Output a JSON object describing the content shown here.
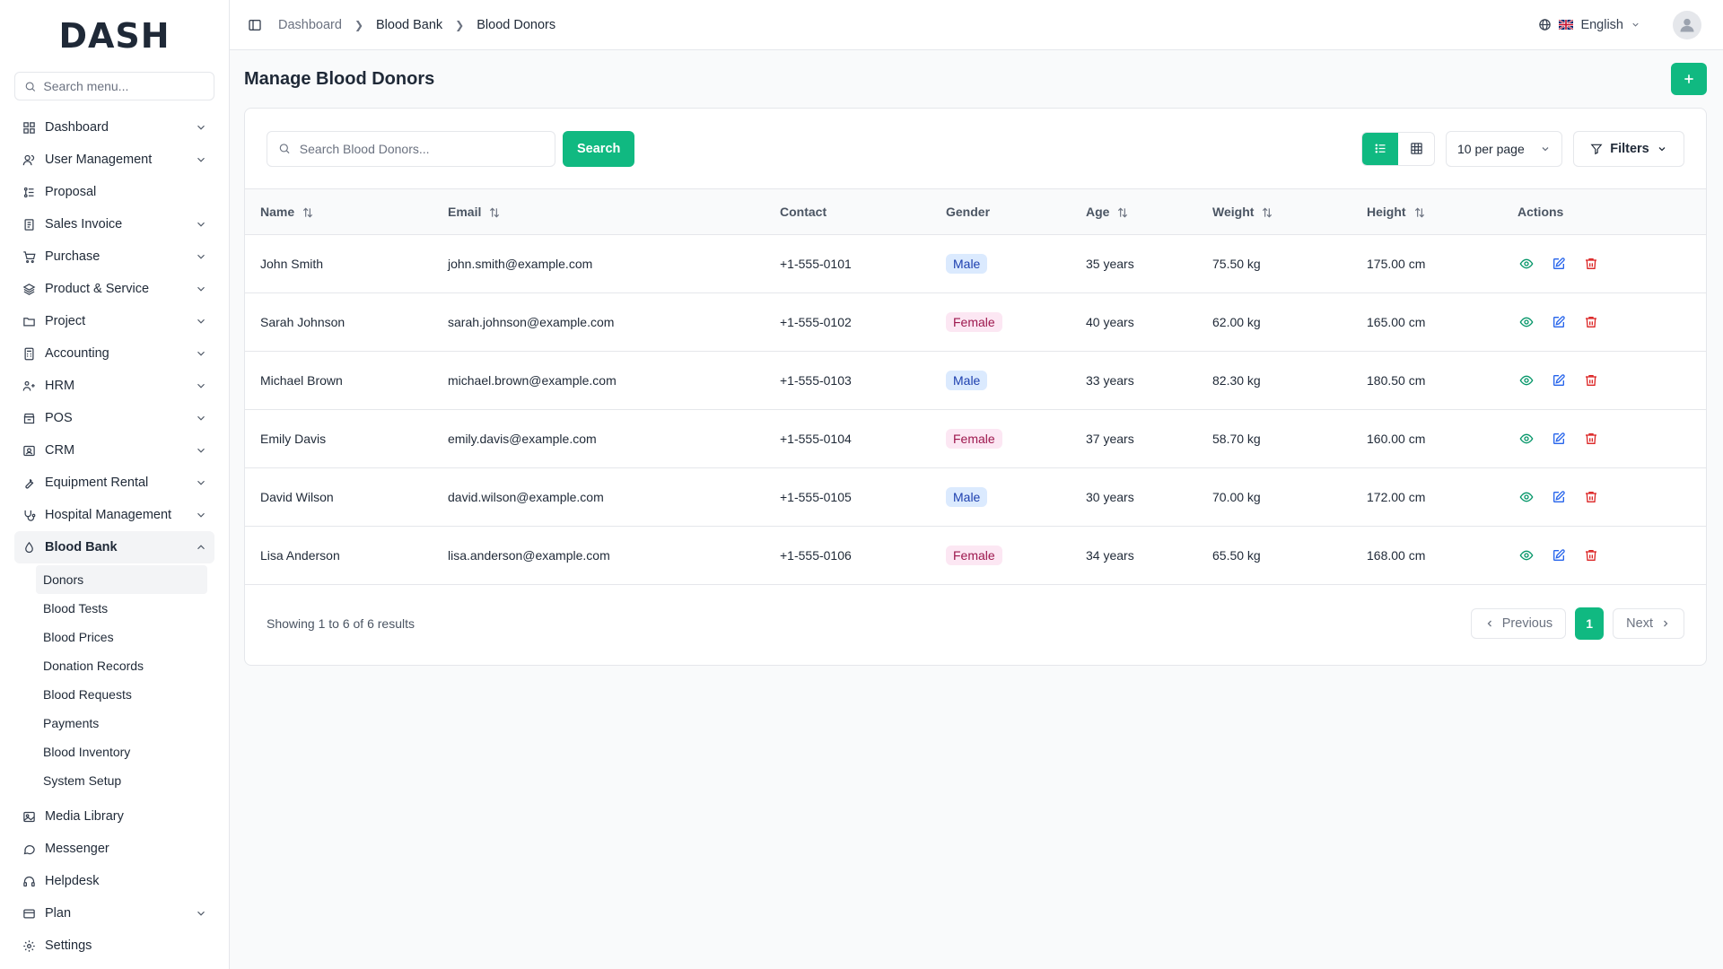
{
  "sidebar": {
    "logo": "DASH",
    "search_placeholder": "Search menu...",
    "items": [
      {
        "label": "Dashboard",
        "icon": "grid-icon",
        "chevron": true
      },
      {
        "label": "User Management",
        "icon": "users-icon",
        "chevron": true
      },
      {
        "label": "Proposal",
        "icon": "proposal-icon",
        "chevron": false
      },
      {
        "label": "Sales Invoice",
        "icon": "invoice-icon",
        "chevron": true
      },
      {
        "label": "Purchase",
        "icon": "cart-icon",
        "chevron": true
      },
      {
        "label": "Product & Service",
        "icon": "layers-icon",
        "chevron": true
      },
      {
        "label": "Project",
        "icon": "folder-icon",
        "chevron": true
      },
      {
        "label": "Accounting",
        "icon": "calculator-icon",
        "chevron": true
      },
      {
        "label": "HRM",
        "icon": "hrm-icon",
        "chevron": true
      },
      {
        "label": "POS",
        "icon": "pos-icon",
        "chevron": true
      },
      {
        "label": "CRM",
        "icon": "crm-icon",
        "chevron": true
      },
      {
        "label": "Equipment Rental",
        "icon": "wrench-icon",
        "chevron": true
      },
      {
        "label": "Hospital Management",
        "icon": "stethoscope-icon",
        "chevron": true
      }
    ],
    "blood_bank": {
      "label": "Blood Bank",
      "icon": "droplet-icon",
      "sub_items": [
        "Donors",
        "Blood Tests",
        "Blood Prices",
        "Donation Records",
        "Blood Requests",
        "Payments",
        "Blood Inventory",
        "System Setup"
      ]
    },
    "bottom_items": [
      {
        "label": "Media Library",
        "icon": "image-icon",
        "chevron": false
      },
      {
        "label": "Messenger",
        "icon": "message-icon",
        "chevron": false
      },
      {
        "label": "Helpdesk",
        "icon": "headset-icon",
        "chevron": false
      },
      {
        "label": "Plan",
        "icon": "card-icon",
        "chevron": true
      },
      {
        "label": "Settings",
        "icon": "gear-icon",
        "chevron": false
      }
    ]
  },
  "topbar": {
    "breadcrumb": [
      "Dashboard",
      "Blood Bank",
      "Blood Donors"
    ],
    "language": "English"
  },
  "page": {
    "title": "Manage Blood Donors",
    "search_placeholder": "Search Blood Donors...",
    "search_button": "Search",
    "per_page": "10 per page",
    "filters": "Filters"
  },
  "table": {
    "columns": [
      "Name",
      "Email",
      "Contact",
      "Gender",
      "Age",
      "Weight",
      "Height",
      "Actions"
    ],
    "rows": [
      {
        "name": "John Smith",
        "email": "john.smith@example.com",
        "contact": "+1-555-0101",
        "gender": "Male",
        "age": "35 years",
        "weight": "75.50 kg",
        "height": "175.00 cm"
      },
      {
        "name": "Sarah Johnson",
        "email": "sarah.johnson@example.com",
        "contact": "+1-555-0102",
        "gender": "Female",
        "age": "40 years",
        "weight": "62.00 kg",
        "height": "165.00 cm"
      },
      {
        "name": "Michael Brown",
        "email": "michael.brown@example.com",
        "contact": "+1-555-0103",
        "gender": "Male",
        "age": "33 years",
        "weight": "82.30 kg",
        "height": "180.50 cm"
      },
      {
        "name": "Emily Davis",
        "email": "emily.davis@example.com",
        "contact": "+1-555-0104",
        "gender": "Female",
        "age": "37 years",
        "weight": "58.70 kg",
        "height": "160.00 cm"
      },
      {
        "name": "David Wilson",
        "email": "david.wilson@example.com",
        "contact": "+1-555-0105",
        "gender": "Male",
        "age": "30 years",
        "weight": "70.00 kg",
        "height": "172.00 cm"
      },
      {
        "name": "Lisa Anderson",
        "email": "lisa.anderson@example.com",
        "contact": "+1-555-0106",
        "gender": "Female",
        "age": "34 years",
        "weight": "65.50 kg",
        "height": "168.00 cm"
      }
    ]
  },
  "pagination": {
    "showing": "Showing 1 to 6 of 6 results",
    "previous": "Previous",
    "current": "1",
    "next": "Next"
  },
  "colors": {
    "accent": "#10b981",
    "view_icon": "#059669",
    "edit_icon": "#2563eb",
    "delete_icon": "#dc2626"
  }
}
